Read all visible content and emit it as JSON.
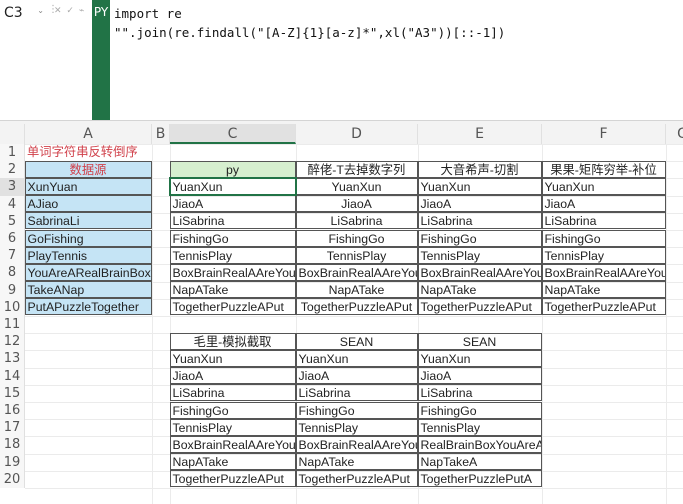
{
  "formula_bar": {
    "name_box": "C3",
    "py_badge": "PY",
    "code_lines": [
      "import re",
      "\"\".join(re.findall(\"[A-Z]{1}[a-z]*\",xl(\"A3\"))[::-1])"
    ]
  },
  "columns": [
    "A",
    "B",
    "C",
    "D",
    "E",
    "F",
    "G"
  ],
  "row_numbers": [
    "1",
    "2",
    "3",
    "4",
    "5",
    "6",
    "7",
    "8",
    "9",
    "10",
    "11",
    "12",
    "13",
    "14",
    "15",
    "16",
    "17",
    "18",
    "19",
    "20"
  ],
  "cells": {
    "A": [
      "单词字符串反转倒序",
      "数据源",
      "XunYuan",
      "AJiao",
      "SabrinaLi",
      "GoFishing",
      "PlayTennis",
      "YouAreARealBrainBox",
      "TakeANap",
      "PutAPuzzleTogether"
    ],
    "C": [
      "",
      "py",
      "YuanXun",
      "JiaoA",
      "LiSabrina",
      "FishingGo",
      "TennisPlay",
      "BoxBrainRealAAreYou",
      "NapATake",
      "TogetherPuzzleAPut",
      "",
      "毛里-模拟截取",
      "YuanXun",
      "JiaoA",
      "LiSabrina",
      "FishingGo",
      "TennisPlay",
      "BoxBrainRealAAreYou",
      "NapATake",
      "TogetherPuzzleAPut"
    ],
    "D": [
      "",
      "醉佬-T去掉数字列",
      "YuanXun",
      "JiaoA",
      "LiSabrina",
      "FishingGo",
      "TennisPlay",
      "BoxBrainRealAAreYou",
      "NapATake",
      "TogetherPuzzleAPut",
      "",
      "SEAN",
      "YuanXun",
      "JiaoA",
      "LiSabrina",
      "FishingGo",
      "TennisPlay",
      "BoxBrainRealAAreYou",
      "NapATake",
      "TogetherPuzzleAPut"
    ],
    "E": [
      "",
      "大音希声-切割",
      "YuanXun",
      "JiaoA",
      "LiSabrina",
      "FishingGo",
      "TennisPlay",
      "BoxBrainRealAAreYou",
      "NapATake",
      "TogetherPuzzleAPut",
      "",
      "SEAN",
      "YuanXun",
      "JiaoA",
      "LiSabrina",
      "FishingGo",
      "TennisPlay",
      "RealBrainBoxYouAreA",
      "NapTakeA",
      "TogetherPuzzlePutA"
    ],
    "F": [
      "",
      "果果-矩阵穷举-补位",
      "YuanXun",
      "JiaoA",
      "LiSabrina",
      "FishingGo",
      "TennisPlay",
      "BoxBrainRealAAreYou",
      "NapATake",
      "TogetherPuzzleAPut"
    ]
  },
  "colors": {
    "accent": "#217346",
    "source_fill": "#c5e4f5",
    "py_header_fill": "#d6efcf",
    "title_red": "#d0404a"
  }
}
